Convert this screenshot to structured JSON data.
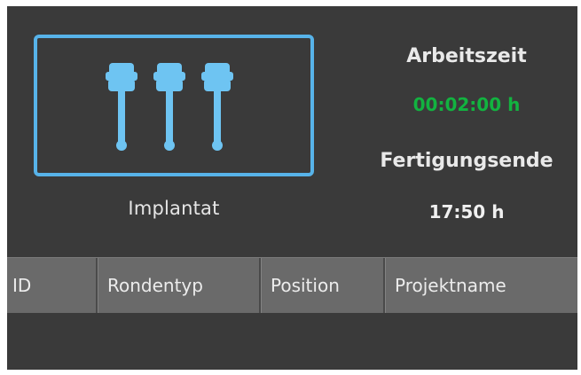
{
  "tool": {
    "label": "Implantat",
    "icon": "implant-tools-icon",
    "accent_color": "#57b3e9"
  },
  "info": {
    "working_time_label": "Arbeitszeit",
    "working_time_value": "00:02:00 h",
    "working_time_color": "#12b340",
    "production_end_label": "Fertigungsende",
    "production_end_value": "17:50 h"
  },
  "table": {
    "columns": [
      "ID",
      "Rondentyp",
      "Position",
      "Projektname"
    ],
    "rows": []
  }
}
